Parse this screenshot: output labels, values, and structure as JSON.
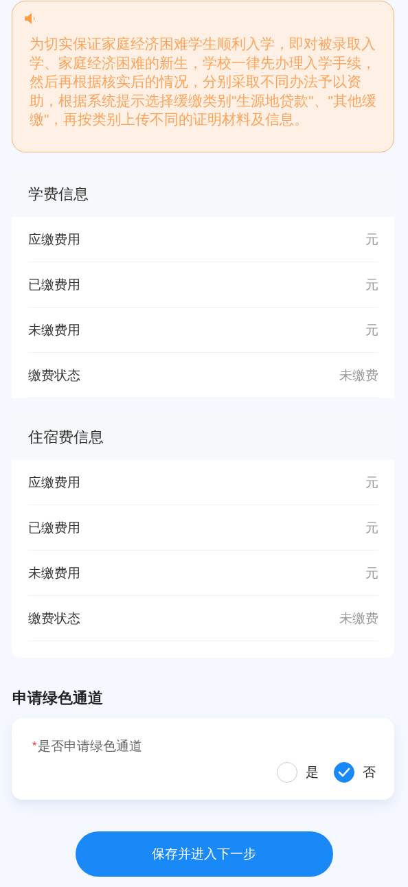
{
  "notice": {
    "text": "为切实保证家庭经济困难学生顺利入学，即对被录取入学、家庭经济困难的新生，学校一律先办理入学手续，然后再根据核实后的情况，分别采取不同办法予以资助，根据系统提示选择缓缴类别\"生源地贷款\"、\"其他缓缴\"，再按类别上传不同的证明材料及信息。"
  },
  "sections": [
    {
      "title": "学费信息",
      "rows": [
        {
          "label": "应缴费用",
          "value": "元"
        },
        {
          "label": "已缴费用",
          "value": "元"
        },
        {
          "label": "未缴费用",
          "value": "元"
        },
        {
          "label": "缴费状态",
          "value": "未缴费"
        }
      ]
    },
    {
      "title": "住宿费信息",
      "rows": [
        {
          "label": "应缴费用",
          "value": "元"
        },
        {
          "label": "已缴费用",
          "value": "元"
        },
        {
          "label": "未缴费用",
          "value": "元"
        },
        {
          "label": "缴费状态",
          "value": "未缴费"
        }
      ]
    }
  ],
  "green_channel": {
    "heading": "申请绿色通道",
    "question": {
      "required_mark": "*",
      "label": "是否申请绿色通道",
      "options": [
        {
          "label": "是",
          "selected": false
        },
        {
          "label": "否",
          "selected": true
        }
      ]
    }
  },
  "submit_button": "保存并进入下一步"
}
